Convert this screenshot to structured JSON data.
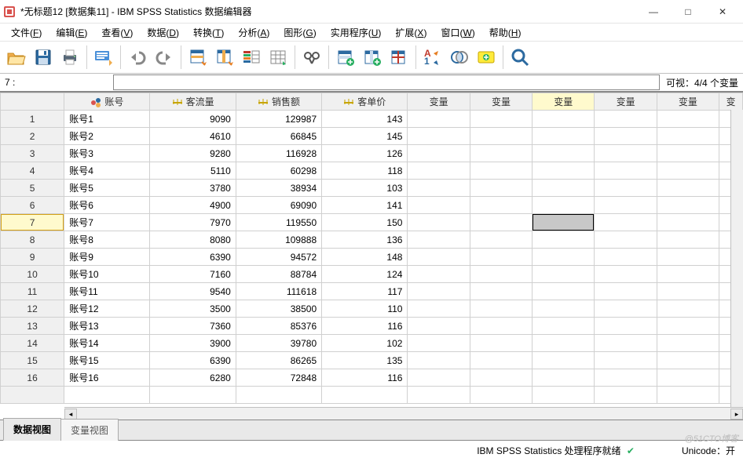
{
  "window": {
    "title": "*无标题12 [数据集11] - IBM SPSS Statistics 数据编辑器",
    "min_icon": "—",
    "max_icon": "□",
    "close_icon": "✕"
  },
  "menu": {
    "items": [
      {
        "label": "文件(",
        "mn": "F",
        "tail": ")"
      },
      {
        "label": "编辑(",
        "mn": "E",
        "tail": ")"
      },
      {
        "label": "查看(",
        "mn": "V",
        "tail": ")"
      },
      {
        "label": "数据(",
        "mn": "D",
        "tail": ")"
      },
      {
        "label": "转换(",
        "mn": "T",
        "tail": ")"
      },
      {
        "label": "分析(",
        "mn": "A",
        "tail": ")"
      },
      {
        "label": "图形(",
        "mn": "G",
        "tail": ")"
      },
      {
        "label": "实用程序(",
        "mn": "U",
        "tail": ")"
      },
      {
        "label": "扩展(",
        "mn": "X",
        "tail": ")"
      },
      {
        "label": "窗口(",
        "mn": "W",
        "tail": ")"
      },
      {
        "label": "帮助(",
        "mn": "H",
        "tail": ")"
      }
    ]
  },
  "toolbar_icons": {
    "open": "open-icon",
    "save": "save-icon",
    "print": "print-icon",
    "recall": "recall-icon",
    "undo": "undo-icon",
    "redo": "redo-icon",
    "goto_case": "goto-case-icon",
    "goto_var": "goto-var-icon",
    "variables": "variables-icon",
    "run": "run-icon",
    "find": "find-icon",
    "insert_case": "insert-case-icon",
    "insert_var": "insert-var-icon",
    "split": "split-icon",
    "weight": "weight-icon",
    "select": "select-icon",
    "value_labels": "value-labels-icon",
    "search": "search-icon"
  },
  "selection_bar": {
    "label": "7 :",
    "value": "",
    "status": "可视：4/4 个变量"
  },
  "columns": {
    "row_header": "",
    "named": [
      {
        "name": "账号",
        "type": "nominal"
      },
      {
        "name": "客流量",
        "type": "scale"
      },
      {
        "name": "销售额",
        "type": "scale"
      },
      {
        "name": "客单价",
        "type": "scale"
      }
    ],
    "placeholder": "变量"
  },
  "rows": [
    {
      "n": 1,
      "c": [
        "账号1",
        "9090",
        "129987",
        "143"
      ]
    },
    {
      "n": 2,
      "c": [
        "账号2",
        "4610",
        "66845",
        "145"
      ]
    },
    {
      "n": 3,
      "c": [
        "账号3",
        "9280",
        "116928",
        "126"
      ]
    },
    {
      "n": 4,
      "c": [
        "账号4",
        "5110",
        "60298",
        "118"
      ]
    },
    {
      "n": 5,
      "c": [
        "账号5",
        "3780",
        "38934",
        "103"
      ]
    },
    {
      "n": 6,
      "c": [
        "账号6",
        "4900",
        "69090",
        "141"
      ]
    },
    {
      "n": 7,
      "c": [
        "账号7",
        "7970",
        "119550",
        "150"
      ]
    },
    {
      "n": 8,
      "c": [
        "账号8",
        "8080",
        "109888",
        "136"
      ]
    },
    {
      "n": 9,
      "c": [
        "账号9",
        "6390",
        "94572",
        "148"
      ]
    },
    {
      "n": 10,
      "c": [
        "账号10",
        "7160",
        "88784",
        "124"
      ]
    },
    {
      "n": 11,
      "c": [
        "账号11",
        "9540",
        "111618",
        "117"
      ]
    },
    {
      "n": 12,
      "c": [
        "账号12",
        "3500",
        "38500",
        "110"
      ]
    },
    {
      "n": 13,
      "c": [
        "账号13",
        "7360",
        "85376",
        "116"
      ]
    },
    {
      "n": 14,
      "c": [
        "账号14",
        "3900",
        "39780",
        "102"
      ]
    },
    {
      "n": 15,
      "c": [
        "账号15",
        "6390",
        "86265",
        "135"
      ]
    },
    {
      "n": 16,
      "c": [
        "账号16",
        "6280",
        "72848",
        "116"
      ]
    }
  ],
  "selected_row": 7,
  "selected_varcol": 2,
  "view_tabs": {
    "data": "数据视图",
    "variable": "变量视图",
    "active": "data"
  },
  "statusbar": {
    "processor": "IBM SPSS Statistics 处理程序就绪",
    "ready_icon": "✔",
    "unicode": "Unicode：开"
  },
  "watermark": "@51CTO博客"
}
